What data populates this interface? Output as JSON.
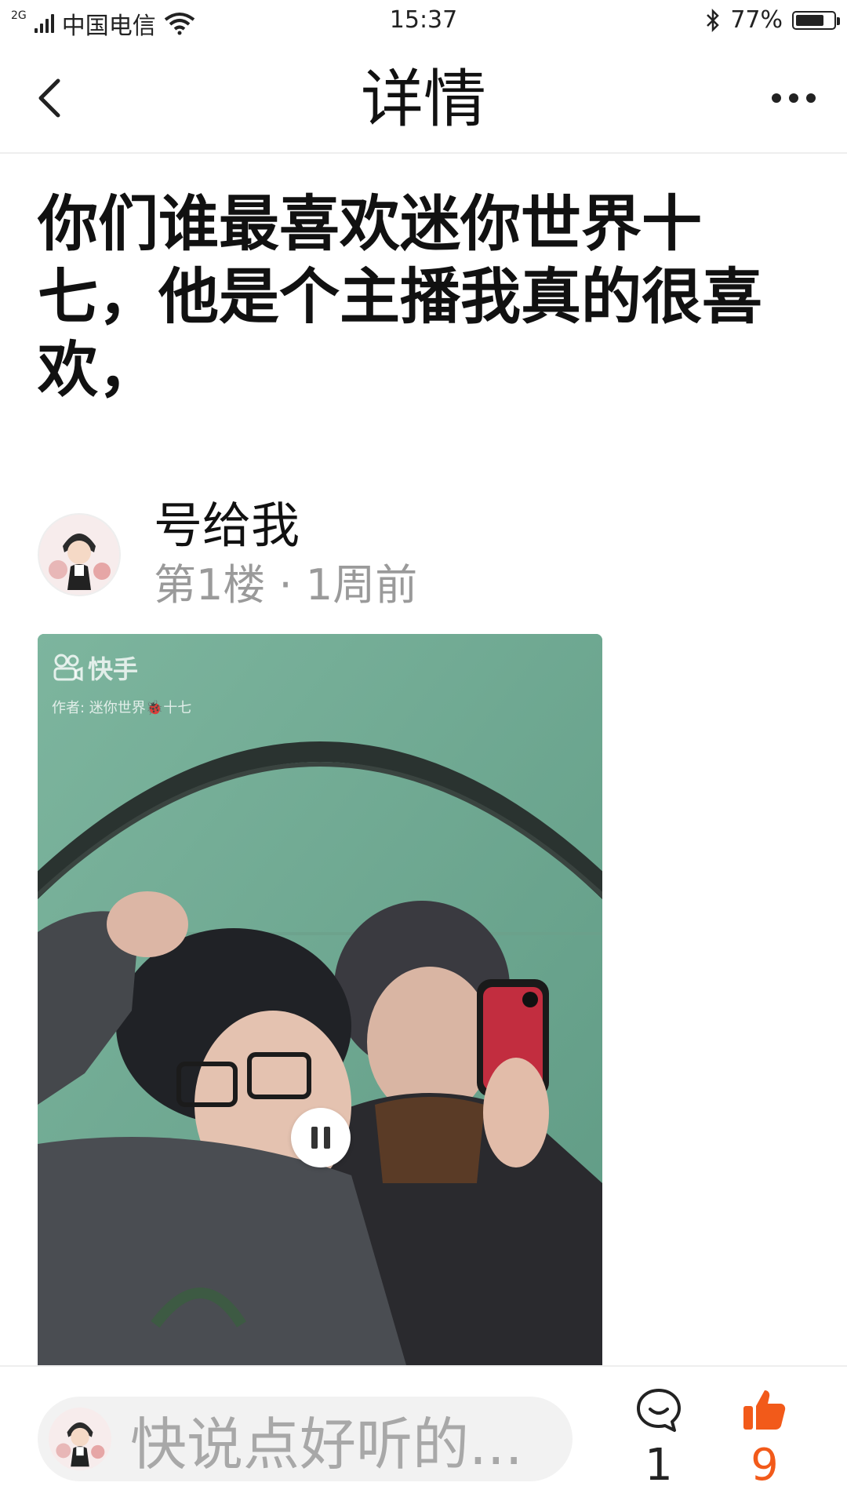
{
  "status_bar": {
    "network": "2G",
    "carrier": "中国电信",
    "time": "15:37",
    "battery_percent": "77%",
    "battery_level": 0.77
  },
  "nav": {
    "title": "详情"
  },
  "post": {
    "title": "你们谁最喜欢迷你世界十七，他是个主播我真的很喜欢，"
  },
  "author": {
    "name": "号给我",
    "meta": "第1楼 · 1周前"
  },
  "video": {
    "watermark_brand": "快手",
    "watermark_author": "作者: 迷你世界🐞十七",
    "state": "playing"
  },
  "bottom": {
    "input_placeholder": "快说点好听的...",
    "comment_count": "1",
    "like_count": "9"
  },
  "colors": {
    "accent": "#f25a1a",
    "muted_text": "#9a9a9a",
    "divider": "#eeeeee"
  }
}
